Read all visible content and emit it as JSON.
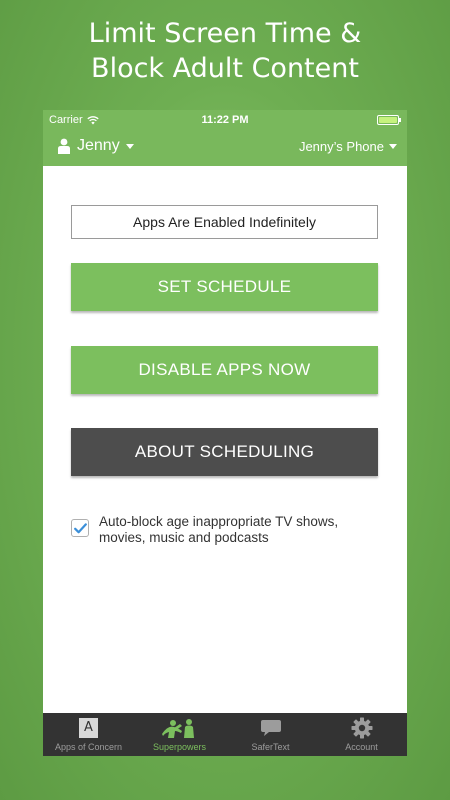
{
  "headline": {
    "line1": "Limit Screen Time &",
    "line2": "Block Adult Content"
  },
  "status_bar": {
    "carrier": "Carrier",
    "time": "11:22 PM",
    "battery_level": 1.0
  },
  "nav": {
    "user_name": "Jenny",
    "device_name": "Jenny’s Phone"
  },
  "main": {
    "status_text": "Apps Are Enabled Indefinitely",
    "set_schedule_label": "SET SCHEDULE",
    "disable_apps_label": "DISABLE APPS NOW",
    "about_scheduling_label": "ABOUT SCHEDULING",
    "autoblock": {
      "checked": true,
      "label": "Auto-block age inappropriate TV shows, movies, music and podcasts"
    }
  },
  "tabs": [
    {
      "label": "Apps of Concern",
      "icon": "apps-of-concern-icon",
      "active": false,
      "glyph": "A"
    },
    {
      "label": "Superpowers",
      "icon": "superpowers-icon",
      "active": true
    },
    {
      "label": "SaferText",
      "icon": "chat-bubble-icon",
      "active": false
    },
    {
      "label": "Account",
      "icon": "gear-icon",
      "active": false
    }
  ],
  "colors": {
    "brand_green": "#7cbf5e",
    "bar_green": "#79b85c",
    "dark_button": "#4d4d4d",
    "tab_bar": "#333333"
  }
}
